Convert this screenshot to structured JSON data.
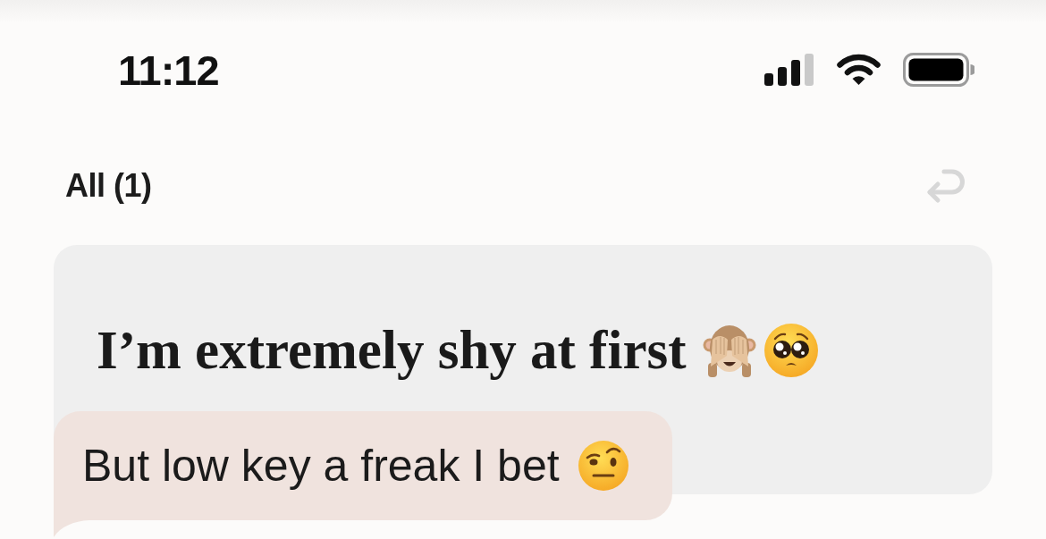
{
  "status_bar": {
    "time": "11:12"
  },
  "header": {
    "filter_label": "All (1)"
  },
  "prompt_card": {
    "prompt": "I’m extremely shy at first"
  },
  "reply_bubble": {
    "text": "But low key a freak I bet"
  }
}
